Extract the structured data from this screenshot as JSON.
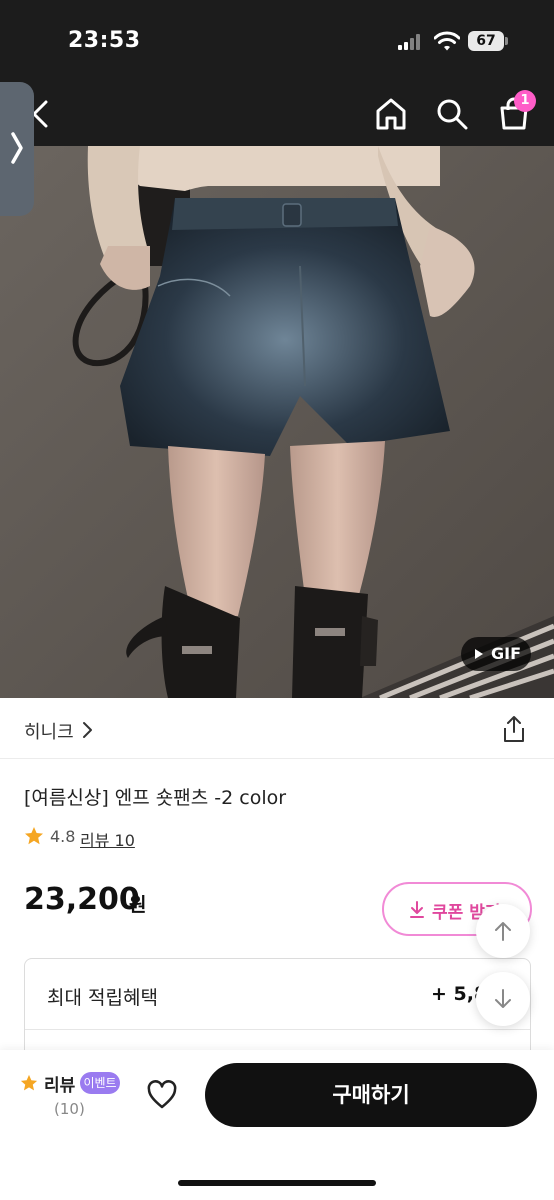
{
  "status_bar": {
    "time": "23:53",
    "battery": "67"
  },
  "header": {
    "cart_count": "1"
  },
  "hero": {
    "badge": "GIF"
  },
  "store": {
    "name": "히니크"
  },
  "product": {
    "title": "[여름신상] 엔프 숏팬츠 -2 color",
    "rating": "4.8",
    "review_link": "리뷰 10",
    "price": "23,200",
    "price_unit": "원",
    "coupon_label": "쿠폰 받기"
  },
  "benefit": {
    "label": "최대 적립혜택",
    "value": "+ 5,8"
  },
  "bottom_bar": {
    "review_label": "리뷰",
    "event_badge": "이벤트",
    "review_count": "(10)",
    "buy_label": "구매하기"
  },
  "colors": {
    "accent_pink": "#ff5dc8",
    "coupon_pink": "#e0489e",
    "event_purple": "#9a7bf0",
    "star": "#f5a623"
  }
}
